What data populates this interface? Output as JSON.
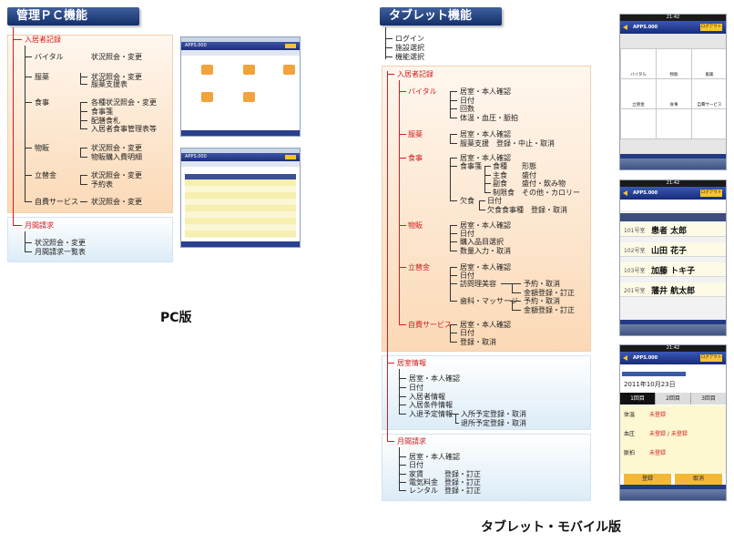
{
  "pc": {
    "header": "管理ＰＣ機能",
    "caption": "PC版",
    "sections": {
      "nyukyosha": "入居者記録",
      "vital": "バイタル",
      "vital_desc": "状況照会・変更",
      "fukuyaku": "服薬",
      "fukuyaku_1": "状況照会・変更",
      "fukuyaku_2": "服薬支援表",
      "shokuji": "食事",
      "shokuji_1": "各種状況照会・変更",
      "shokuji_2": "食事箋",
      "shokuji_3": "配膳食札",
      "shokuji_4": "入居者食事管理表等",
      "buppan": "物販",
      "buppan_1": "状況照会・変更",
      "buppan_2": "物販購入費明細",
      "tatekae": "立替金",
      "tatekae_1": "状況照会・変更",
      "tatekae_2": "予約表",
      "jihi": "自費サービス",
      "jihi_1": "状況照会・変更",
      "getsuma": "月間請求",
      "getsuma_1": "状況照会・変更",
      "getsuma_2": "月間請求一覧表"
    },
    "screens": {
      "logo": "APPS.000"
    }
  },
  "tablet": {
    "header": "タブレット機能",
    "caption": "タブレット・モバイル版",
    "top": [
      "ログイン",
      "施設選択",
      "機能選択"
    ],
    "sections": {
      "nyukyosha": "入居者記録",
      "vital": "バイタル",
      "vital_items": [
        "居室・本人確認",
        "日付",
        "回数",
        "体温・血圧・脈拍"
      ],
      "fukuyaku": "服薬",
      "fukuyaku_items": [
        "居室・本人確認",
        "服薬支援　登録・中止・取消"
      ],
      "shokuji": "食事",
      "shokuji_items": [
        "居室・本人確認",
        "食事箋"
      ],
      "shokusen_items": [
        "食種　　形態",
        "主食　　盛付",
        "副食　　盛付・飲み物",
        "制限食　その他・カロリー"
      ],
      "kesshoku": "欠食",
      "kesshoku_items": [
        "日付",
        "欠食食事種　登録・取消"
      ],
      "buppan": "物販",
      "buppan_items": [
        "居室・本人確認",
        "日付",
        "購入品目選択",
        "数量入力・取消"
      ],
      "tatekae": "立替金",
      "tatekae_items": [
        "居室・本人確認",
        "日付"
      ],
      "houmon": "訪問理美容",
      "houmon_items": [
        "予約・取消",
        "金額登録・訂正"
      ],
      "massage": "歯科・マッサージ",
      "massage_items": [
        "予約・取消",
        "金額登録・訂正"
      ],
      "jihi": "自費サービス",
      "jihi_items": [
        "居室・本人確認",
        "日付",
        "登録・取消"
      ],
      "kyoshitsu": "居室情報",
      "kyoshitsu_items": [
        "居室・本人確認",
        "日付",
        "入居者情報",
        "入居条件情報",
        "入退予定情報"
      ],
      "nyutai_items": [
        "入所予定登録・取消",
        "退所予定登録・取消"
      ],
      "getsuma": "月間請求",
      "getsuma_items": [
        "居室・本人確認",
        "日付"
      ],
      "getsuma_sub": [
        "家賃",
        "電気料金",
        "レンタル"
      ],
      "getsuma_sub_action": "登録・訂正"
    },
    "phone": {
      "logo": "APPS.000",
      "logout": "ログアウト",
      "time": "21:42",
      "carrier": "iPod",
      "tiles": [
        "バイタル",
        "物販",
        "服薬",
        "立替金",
        "食事",
        "自費サービス"
      ],
      "residents": [
        {
          "room": "101号室",
          "name": "患者 太郎"
        },
        {
          "room": "102号室",
          "name": "山田 花子"
        },
        {
          "room": "103号室",
          "name": "加藤 トキ子"
        },
        {
          "room": "201号室",
          "name": "藩井 航太郎"
        }
      ],
      "date": "2011年10月23日",
      "tabs": [
        "1回目",
        "2回目",
        "3回目"
      ],
      "vitals": [
        {
          "label": "体温",
          "value": "未登録"
        },
        {
          "label": "血圧",
          "value": "未登録 / 未登録"
        },
        {
          "label": "脈拍",
          "value": "未登録"
        }
      ],
      "register": "登録",
      "cancel": "取消"
    }
  }
}
